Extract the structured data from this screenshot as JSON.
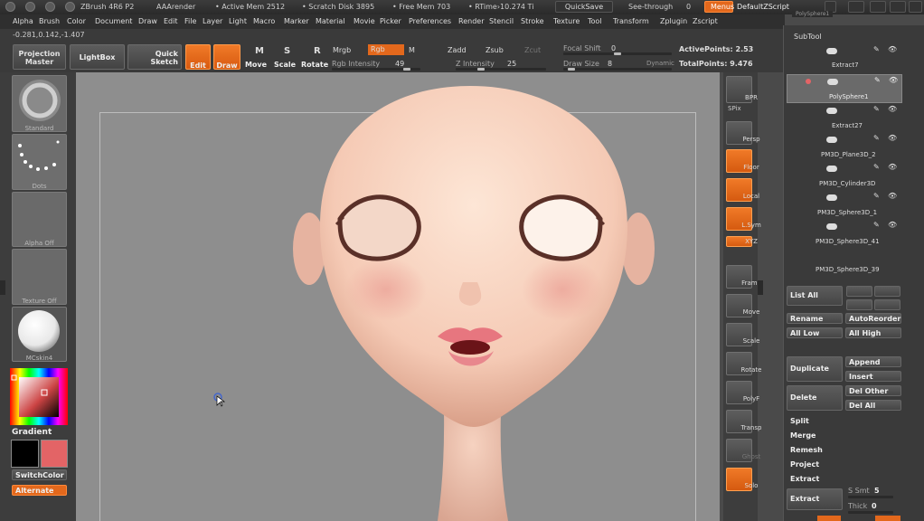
{
  "titlebar": {
    "app": "ZBrush 4R6 P2",
    "aa": "AAArender",
    "active_mem": "• Active Mem 2512",
    "scratch": "• Scratch Disk 3895",
    "free_mem": "• Free Mem 703",
    "rtime": "• RTime›10.274 Ti",
    "quicksave": "QuickSave",
    "seethrough": "See-through",
    "seethrough_val": "0",
    "menus": "Menus",
    "script": "DefaultZScript"
  },
  "menu": [
    "Alpha",
    "Brush",
    "Color",
    "Document",
    "Draw",
    "Edit",
    "File",
    "Layer",
    "Light",
    "Macro",
    "Marker",
    "Material",
    "Movie",
    "Picker",
    "Preferences",
    "Render",
    "Stencil",
    "Stroke",
    "Texture",
    "Tool",
    "Transform",
    "Zplugin",
    "Zscript"
  ],
  "coords": "-0.281,0.142,-1.407",
  "toolbar": {
    "projection": "Projection\nMaster",
    "lightbox": "LightBox",
    "quicksketch": "Quick\nSketch",
    "edit": "Edit",
    "draw": "Draw",
    "move": "Move",
    "scale": "Scale",
    "rotate": "Rotate",
    "mrgb": "Mrgb",
    "rgb": "Rgb",
    "m": "M",
    "zadd": "Zadd",
    "zsub": "Zsub",
    "zcut": "Zcut",
    "rgb_intensity_label": "Rgb Intensity",
    "rgb_intensity": "49",
    "z_intensity_label": "Z Intensity",
    "z_intensity": "25",
    "focal_label": "Focal Shift",
    "focal": "0",
    "drawsize_label": "Draw Size",
    "drawsize": "8",
    "dynamic": "Dynamic",
    "active_points": "ActivePoints: 2.53",
    "total_points": "TotalPoints: 9.476"
  },
  "leftshelf": {
    "standard": "Standard",
    "dots": "Dots",
    "alpha": "Alpha  Off",
    "texture": "Texture  Off",
    "matcap": "MCskin4",
    "gradient": "Gradient",
    "switchcolor": "SwitchColor",
    "alternate": "Alternate",
    "colors": {
      "main": "#000000",
      "secondary": "#e36466",
      "accent": "#e3681c"
    }
  },
  "rightshelf": [
    "BPR",
    "SPix",
    "Persp",
    "Floor",
    "Local",
    "L.Sym",
    "XYZ",
    "Frame",
    "Move",
    "Scale",
    "Rotate",
    "PolyF",
    "Transp",
    "Ghost",
    "Solo"
  ],
  "subtool": {
    "title": "SubTool",
    "top_clip": "PolySphere1",
    "items": [
      "Extract7",
      "PolySphere1",
      "Extract27",
      "PM3D_Plane3D_2",
      "PM3D_Cylinder3D",
      "PM3D_Sphere3D_1",
      "PM3D_Sphere3D_41",
      "PM3D_Sphere3D_39"
    ],
    "list_all": "List  All",
    "rename": "Rename",
    "autoreorder": "AutoReorder",
    "all_low": "All Low",
    "all_high": "All High",
    "duplicate": "Duplicate",
    "append": "Append",
    "insert": "Insert",
    "delete": "Delete",
    "del_other": "Del Other",
    "del_all": "Del All",
    "split": "Split",
    "merge": "Merge",
    "remesh": "Remesh",
    "project": "Project",
    "extract_label": "Extract",
    "extract_btn": "Extract",
    "s_smt_label": "S Smt",
    "s_smt": "5",
    "thick_label": "Thick",
    "thick": "0"
  }
}
